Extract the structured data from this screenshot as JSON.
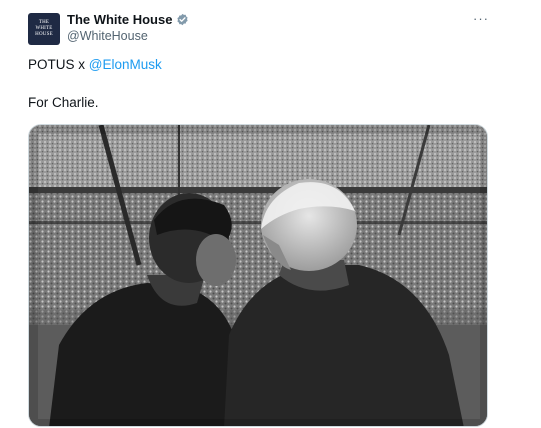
{
  "account": {
    "display_name": "The White House",
    "handle": "@WhiteHouse",
    "avatar_lines": [
      "THE",
      "WHITE",
      "HOUSE"
    ],
    "verified_color": "#829aab"
  },
  "post": {
    "line1_prefix": "POTUS x ",
    "mention": "@ElonMusk",
    "line2": "For Charlie."
  },
  "menu": {
    "more_label": "···"
  },
  "colors": {
    "link": "#1d9bf0",
    "secondary_text": "#536471",
    "primary_text": "#0f1419"
  },
  "media": {
    "style": "black-and-white photo",
    "icon": "photo-image"
  }
}
